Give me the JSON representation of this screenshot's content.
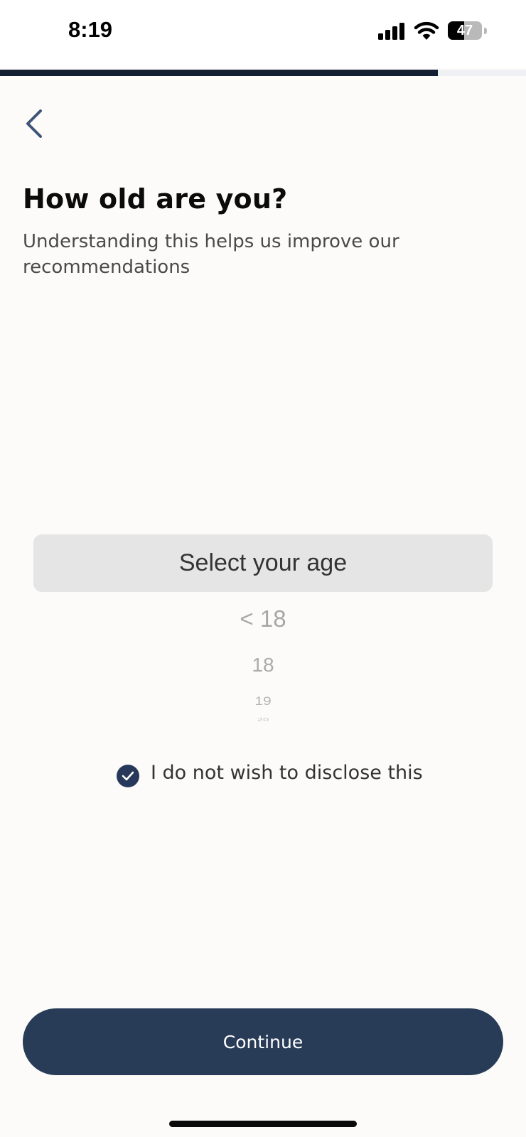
{
  "status_bar": {
    "time": "8:19",
    "battery_level": 47,
    "battery_label": "47",
    "icons": [
      "signal-icon",
      "wifi-icon",
      "battery-icon"
    ]
  },
  "progress": {
    "fraction": 0.833
  },
  "header": {
    "back_icon": "chevron-left-icon",
    "title": "How old are you?",
    "subtitle": "Understanding this helps us improve our recommendations"
  },
  "age_picker": {
    "selected_label": "Select your age",
    "options": [
      "< 18",
      "18",
      "19",
      "20"
    ]
  },
  "disclose": {
    "checked": true,
    "label": "I do not wish to disclose this",
    "icon": "checkmark-icon"
  },
  "footer": {
    "continue_label": "Continue"
  },
  "colors": {
    "background": "#fcfbf9",
    "primary": "#283b57",
    "progress": "#141e33",
    "picker_highlight": "#e5e5e5"
  }
}
